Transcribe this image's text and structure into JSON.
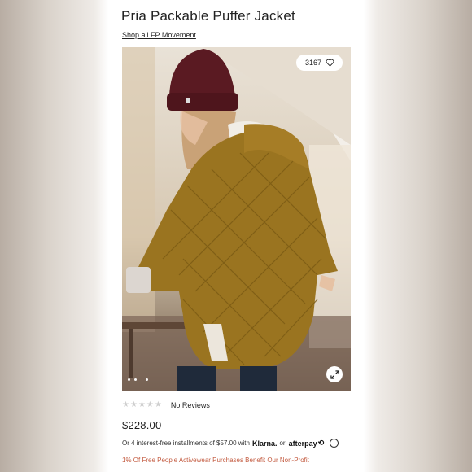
{
  "product": {
    "title": "Pria Packable Puffer Jacket",
    "shop_link": "Shop all FP Movement",
    "likes": "3167",
    "reviews_label": "No Reviews",
    "rating_stars": 0,
    "price": "$228.00"
  },
  "payment": {
    "installments_text": "Or 4 interest-free installments of $57.00 with",
    "klarna": "Klarna.",
    "or": "or",
    "afterpay": "afterpay",
    "afterpay_mark": "⟲"
  },
  "promo": {
    "text": "1% Of Free People Activewear Purchases Benefit Our Non-Profit"
  },
  "gallery": {
    "active_image": 1,
    "image_count": 3
  },
  "icons": [
    "heart-icon",
    "expand-icon",
    "star-icon",
    "info-icon"
  ],
  "colors": {
    "promo": "#c35a3f",
    "jacket": "#9a7420",
    "beanie": "#5a1a22",
    "star_empty": "#cfcfcf"
  }
}
